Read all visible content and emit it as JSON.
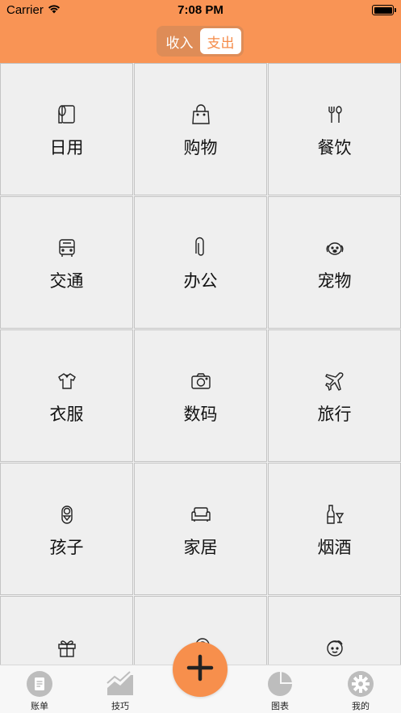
{
  "status_bar": {
    "carrier": "Carrier",
    "time": "7:08 PM"
  },
  "segmented": {
    "options": [
      "收入",
      "支出"
    ],
    "selected": "支出"
  },
  "categories": [
    {
      "label": "日用",
      "icon": "paper-towel-icon"
    },
    {
      "label": "购物",
      "icon": "shopping-bag-icon"
    },
    {
      "label": "餐饮",
      "icon": "utensils-icon"
    },
    {
      "label": "交通",
      "icon": "bus-icon"
    },
    {
      "label": "办公",
      "icon": "paperclip-icon"
    },
    {
      "label": "宠物",
      "icon": "dog-icon"
    },
    {
      "label": "衣服",
      "icon": "tshirt-icon"
    },
    {
      "label": "数码",
      "icon": "camera-icon"
    },
    {
      "label": "旅行",
      "icon": "airplane-icon"
    },
    {
      "label": "孩子",
      "icon": "baby-icon"
    },
    {
      "label": "家居",
      "icon": "sofa-icon"
    },
    {
      "label": "烟酒",
      "icon": "wine-icon"
    },
    {
      "label": "",
      "icon": "gift-icon"
    },
    {
      "label": "",
      "icon": "search-icon"
    },
    {
      "label": "",
      "icon": "beauty-icon"
    }
  ],
  "tabbar": {
    "items": [
      {
        "label": "账单",
        "icon": "bill-icon"
      },
      {
        "label": "技巧",
        "icon": "trend-chart-icon"
      },
      {
        "label": "图表",
        "icon": "pie-chart-icon"
      },
      {
        "label": "我的",
        "icon": "settings-icon"
      }
    ],
    "add_icon": "plus-icon"
  },
  "colors": {
    "accent": "#f99455",
    "tab_icon": "#bdbdbd"
  }
}
